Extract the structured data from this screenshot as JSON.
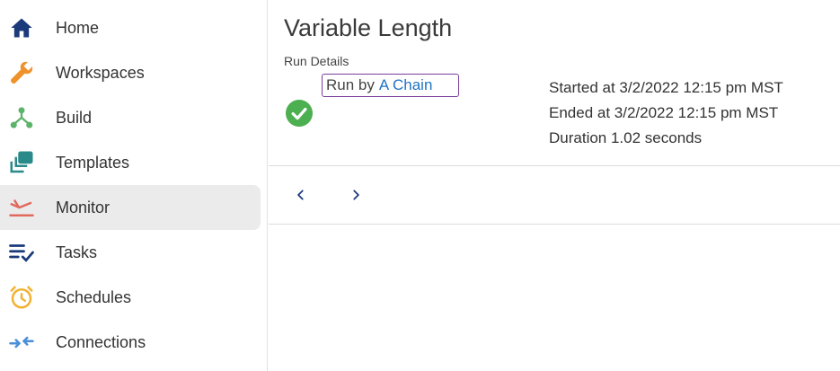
{
  "sidebar": {
    "items": [
      {
        "label": "Home",
        "icon": "home-icon"
      },
      {
        "label": "Workspaces",
        "icon": "wrench-icon"
      },
      {
        "label": "Build",
        "icon": "build-icon"
      },
      {
        "label": "Templates",
        "icon": "templates-icon"
      },
      {
        "label": "Monitor",
        "icon": "monitor-icon",
        "active": true
      },
      {
        "label": "Tasks",
        "icon": "tasks-icon"
      },
      {
        "label": "Schedules",
        "icon": "alarm-clock-icon"
      },
      {
        "label": "Connections",
        "icon": "connections-icon"
      }
    ]
  },
  "main": {
    "title": "Variable Length",
    "subtitle": "Run Details",
    "run_by_prefix": "Run by",
    "run_by_link": "A Chain",
    "status": "success",
    "started": "Started at 3/2/2022 12:15 pm MST",
    "ended": "Ended at 3/2/2022 12:15 pm MST",
    "duration": "Duration 1.02 seconds"
  },
  "pagination": {
    "prev_icon": "chevron-left-icon",
    "next_icon": "chevron-right-icon"
  },
  "colors": {
    "home": "#1a3a7a",
    "workspaces": "#f0922b",
    "build": "#5cb36a",
    "templates": "#2a8a8a",
    "monitor": "#e06a5c",
    "tasks": "#1a3a7a",
    "schedules": "#f2b233",
    "connections": "#4a90d9",
    "success": "#4caf50",
    "link": "#1f74c4",
    "focus_border": "#7a3e9d"
  }
}
